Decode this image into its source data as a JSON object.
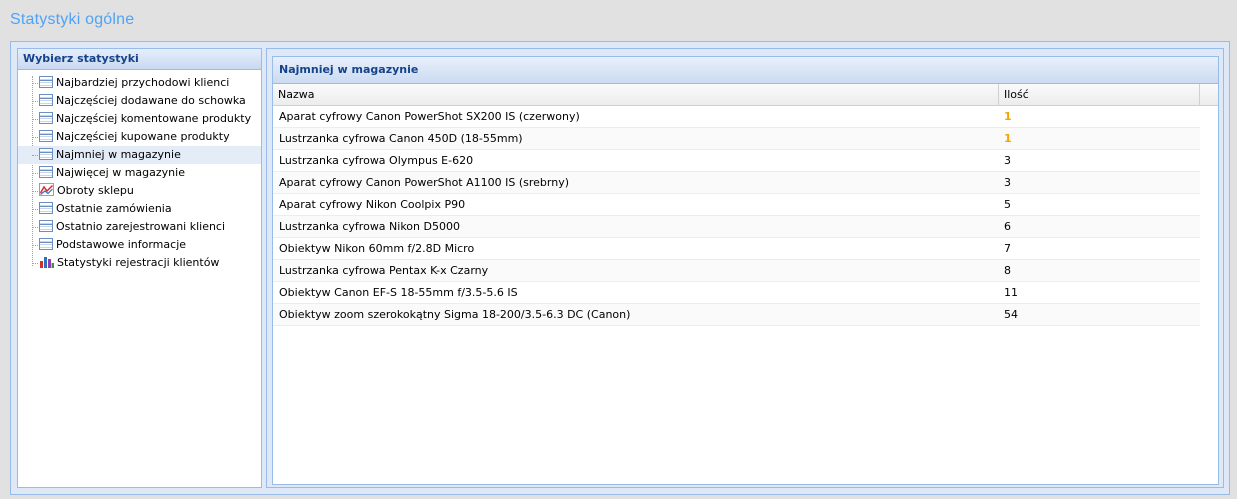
{
  "page": {
    "title": "Statystyki ogólne"
  },
  "sidebar": {
    "title": "Wybierz statystyki",
    "items": [
      {
        "label": "Najbardziej przychodowi klienci",
        "icon": "table-icon"
      },
      {
        "label": "Najczęściej dodawane do schowka",
        "icon": "table-icon"
      },
      {
        "label": "Najczęściej komentowane produkty",
        "icon": "table-icon"
      },
      {
        "label": "Najczęściej kupowane produkty",
        "icon": "table-icon"
      },
      {
        "label": "Najmniej w magazynie",
        "icon": "table-icon",
        "selected": true
      },
      {
        "label": "Najwięcej w magazynie",
        "icon": "table-icon"
      },
      {
        "label": "Obroty sklepu",
        "icon": "line-chart-icon"
      },
      {
        "label": "Ostatnie zamówienia",
        "icon": "table-icon"
      },
      {
        "label": "Ostatnio zarejestrowani klienci",
        "icon": "table-icon"
      },
      {
        "label": "Podstawowe informacje",
        "icon": "table-icon"
      },
      {
        "label": "Statystyki rejestracji klientów",
        "icon": "bar-chart-icon"
      }
    ]
  },
  "grid": {
    "title": "Najmniej w magazynie",
    "columns": {
      "name": "Nazwa",
      "qty": "Ilość"
    },
    "rows": [
      {
        "name": "Aparat cyfrowy Canon PowerShot SX200 IS (czerwony)",
        "qty": "1"
      },
      {
        "name": "Lustrzanka cyfrowa Canon 450D (18-55mm)",
        "qty": "1"
      },
      {
        "name": "Lustrzanka cyfrowa Olympus E-620",
        "qty": "3"
      },
      {
        "name": "Aparat cyfrowy Canon PowerShot A1100 IS (srebrny)",
        "qty": "3"
      },
      {
        "name": "Aparat cyfrowy Nikon Coolpix P90",
        "qty": "5"
      },
      {
        "name": "Lustrzanka cyfrowa Nikon D5000",
        "qty": "6"
      },
      {
        "name": "Obiektyw Nikon 60mm f/2.8D Micro",
        "qty": "7"
      },
      {
        "name": "Lustrzanka cyfrowa Pentax K-x Czarny",
        "qty": "8"
      },
      {
        "name": "Obiektyw Canon EF-S 18-55mm f/3.5-5.6 IS",
        "qty": "11"
      },
      {
        "name": "Obiektyw zoom szerokokątny Sigma 18-200/3.5-6.3 DC (Canon)",
        "qty": "54"
      }
    ],
    "low_stock_color": "#f3a500"
  }
}
